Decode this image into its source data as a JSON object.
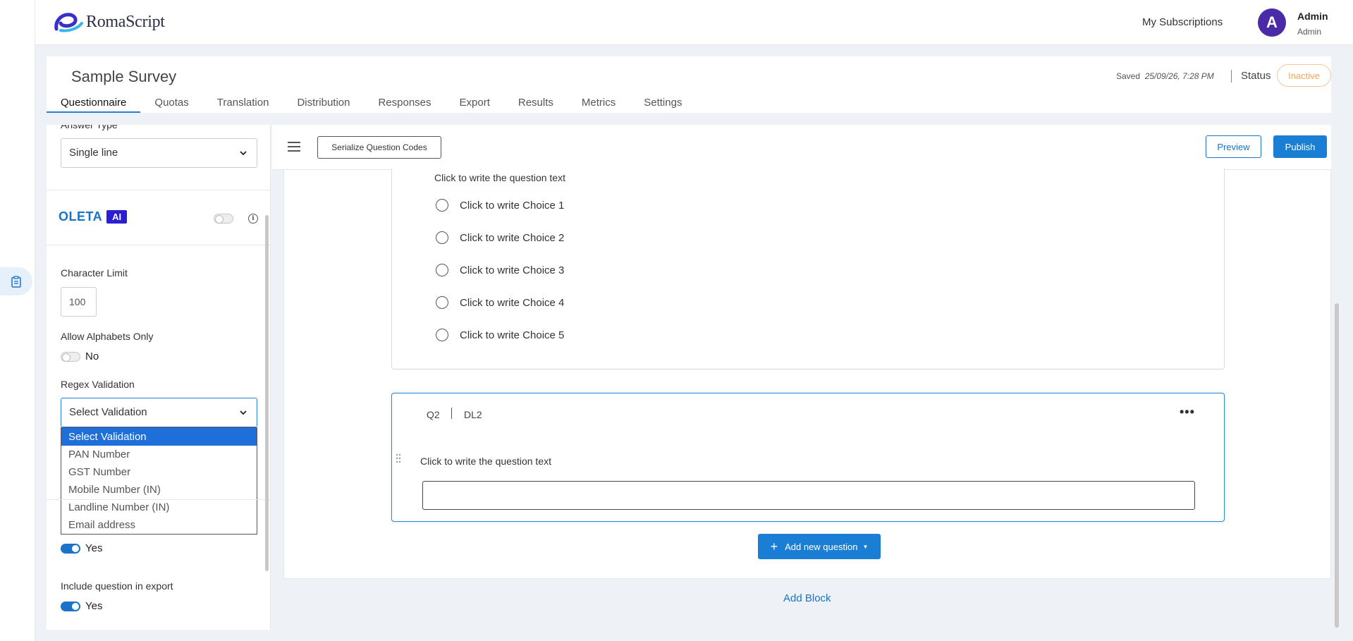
{
  "app": {
    "brand": "RomaScript",
    "my_subscriptions": "My Subscriptions",
    "user": {
      "initial": "A",
      "name": "Admin",
      "role": "Admin"
    }
  },
  "survey": {
    "title": "Sample Survey",
    "saved_label": "Saved",
    "saved_time": "25/09/26, 7:28 PM",
    "status_label": "Status",
    "status_value": "Inactive",
    "tabs": [
      {
        "label": "Questionnaire",
        "active": true
      },
      {
        "label": "Quotas"
      },
      {
        "label": "Translation"
      },
      {
        "label": "Distribution"
      },
      {
        "label": "Responses"
      },
      {
        "label": "Export"
      },
      {
        "label": "Results"
      },
      {
        "label": "Metrics"
      },
      {
        "label": "Settings"
      }
    ]
  },
  "panel": {
    "answer_type_label": "Answer Type",
    "answer_type_value": "Single line",
    "oleta": "OLETA",
    "ai": "AI",
    "char_limit_label": "Character Limit",
    "char_limit_value": "100",
    "alpha_only_label": "Allow Alphabets Only",
    "alpha_only_value": "No",
    "regex_label": "Regex Validation",
    "regex_value": "Select Validation",
    "regex_options": [
      "Select Validation",
      "PAN Number",
      "GST Number",
      "Mobile Number (IN)",
      "Landline Number (IN)",
      "Email address"
    ],
    "hidden_toggle_value": "Yes",
    "export_label": "Include question in export",
    "export_value": "Yes"
  },
  "editor": {
    "serialize_label": "Serialize Question Codes",
    "preview_label": "Preview",
    "publish_label": "Publish",
    "q1": {
      "text": "Click to write the question text",
      "choices": [
        "Click to write Choice 1",
        "Click to write Choice 2",
        "Click to write Choice 3",
        "Click to write Choice 4",
        "Click to write Choice 5"
      ]
    },
    "q2": {
      "code": "Q2",
      "type": "DL2",
      "text": "Click to write the question text"
    },
    "add_question_label": "Add new question",
    "add_block_label": "Add Block"
  },
  "colors": {
    "accent": "#1a7fd4",
    "avatar": "#4b2aa8",
    "ai_badge": "#2a1fd4",
    "status_inactive": "#f0a860"
  }
}
